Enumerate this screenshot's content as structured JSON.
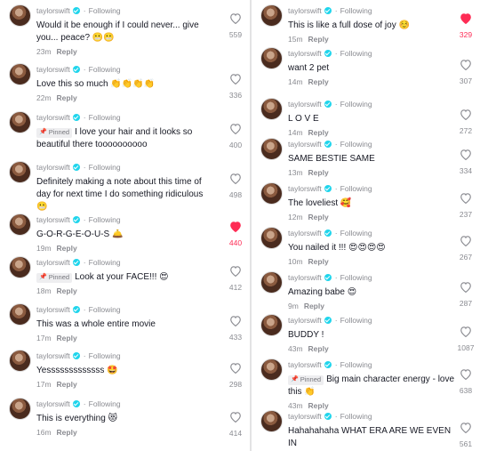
{
  "left": [
    {
      "username": "taylorswift",
      "following": "Following",
      "pinned": "",
      "text": "Would it be enough if I could never... give you... peace? 😬😬",
      "time": "23m",
      "reply": "Reply",
      "likes": "559",
      "liked": false
    },
    {
      "username": "taylorswift",
      "following": "Following",
      "pinned": "",
      "text": "Love this so much 👏👏👏👏",
      "time": "22m",
      "reply": "Reply",
      "likes": "336",
      "liked": false
    },
    {
      "username": "taylorswift",
      "following": "Following",
      "pinned": "Pinned",
      "text": "I love your hair and it looks so beautiful there toooooooooo",
      "time": "",
      "reply": "",
      "likes": "400",
      "liked": false
    },
    {
      "username": "taylorswift",
      "following": "Following",
      "pinned": "",
      "text": "Definitely making a note about this time of day for next time I do something ridiculous 😬",
      "time": "",
      "reply": "",
      "likes": "498",
      "liked": false
    },
    {
      "username": "taylorswift",
      "following": "Following",
      "pinned": "",
      "text": "G-O-R-G-E-O-U-S 🛎️",
      "time": "19m",
      "reply": "Reply",
      "likes": "440",
      "liked": true
    },
    {
      "username": "taylorswift",
      "following": "Following",
      "pinned": "Pinned",
      "text": "Look at your FACE!!! 😍",
      "time": "18m",
      "reply": "Reply",
      "likes": "412",
      "liked": false
    },
    {
      "username": "taylorswift",
      "following": "Following",
      "pinned": "",
      "text": "This was a whole entire movie",
      "time": "17m",
      "reply": "Reply",
      "likes": "433",
      "liked": false
    },
    {
      "username": "taylorswift",
      "following": "Following",
      "pinned": "",
      "text": "Yesssssssssssss 🤩",
      "time": "17m",
      "reply": "Reply",
      "likes": "298",
      "liked": false
    },
    {
      "username": "taylorswift",
      "following": "Following",
      "pinned": "",
      "text": "This is everything 😻",
      "time": "16m",
      "reply": "Reply",
      "likes": "414",
      "liked": false
    }
  ],
  "right": [
    {
      "username": "taylorswift",
      "following": "Following",
      "pinned": "",
      "text": "This is like a full dose of joy ☺️",
      "time": "15m",
      "reply": "Reply",
      "likes": "329",
      "liked": true
    },
    {
      "username": "taylorswift",
      "following": "Following",
      "pinned": "",
      "text": "want 2 pet",
      "time": "14m",
      "reply": "Reply",
      "likes": "307",
      "liked": false
    },
    {
      "username": "taylorswift",
      "following": "Following",
      "pinned": "",
      "text": "L O V E",
      "time": "14m",
      "reply": "Reply",
      "likes": "272",
      "liked": false
    },
    {
      "username": "taylorswift",
      "following": "Following",
      "pinned": "",
      "text": "SAME BESTIE SAME",
      "time": "13m",
      "reply": "Reply",
      "likes": "334",
      "liked": false
    },
    {
      "username": "taylorswift",
      "following": "Following",
      "pinned": "",
      "text": "The loveliest 🥰",
      "time": "12m",
      "reply": "Reply",
      "likes": "237",
      "liked": false
    },
    {
      "username": "taylorswift",
      "following": "Following",
      "pinned": "",
      "text": "You nailed it !!! 😍😍😍😍",
      "time": "10m",
      "reply": "Reply",
      "likes": "267",
      "liked": false
    },
    {
      "username": "taylorswift",
      "following": "Following",
      "pinned": "",
      "text": "Amazing babe 😍",
      "time": "9m",
      "reply": "Reply",
      "likes": "287",
      "liked": false
    },
    {
      "username": "taylorswift",
      "following": "Following",
      "pinned": "",
      "text": "BUDDY !",
      "time": "43m",
      "reply": "Reply",
      "likes": "1087",
      "liked": false
    },
    {
      "username": "taylorswift",
      "following": "Following",
      "pinned": "Pinned",
      "text": "Big main character energy - love this 👏",
      "time": "43m",
      "reply": "Reply",
      "likes": "638",
      "liked": false
    },
    {
      "username": "taylorswift",
      "following": "Following",
      "pinned": "",
      "text": "Hahahahaha WHAT ERA ARE WE EVEN IN",
      "time": "44m",
      "reply": "Reply",
      "likes": "561",
      "liked": false
    }
  ],
  "colors": {
    "liked": "#fe2c55",
    "muted": "#8a8b91",
    "verified": "#20d5ec"
  }
}
